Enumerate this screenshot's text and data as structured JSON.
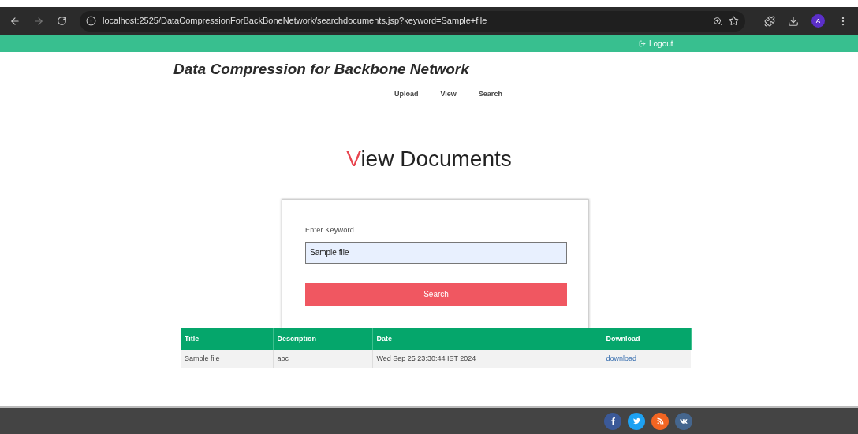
{
  "browser": {
    "url": "localhost:2525/DataCompressionForBackBoneNetwork/searchdocuments.jsp?keyword=Sample+file",
    "avatar": "A"
  },
  "topbar": {
    "logout": "Logout"
  },
  "site_title": "Data Compression for Backbone Network",
  "nav": [
    {
      "label": "Upload"
    },
    {
      "label": "View"
    },
    {
      "label": "Search"
    }
  ],
  "heading": {
    "accent": "V",
    "rest": "iew Documents"
  },
  "search_form": {
    "label": "Enter Keyword",
    "value": "Sample file",
    "button": "Search"
  },
  "table": {
    "columns": [
      "Title",
      "Description",
      "Date",
      "Download"
    ],
    "rows": [
      {
        "cells": [
          "Sample file",
          "abc",
          "Wed Sep 25 23:30:44 IST 2024"
        ],
        "link": "download"
      }
    ]
  }
}
